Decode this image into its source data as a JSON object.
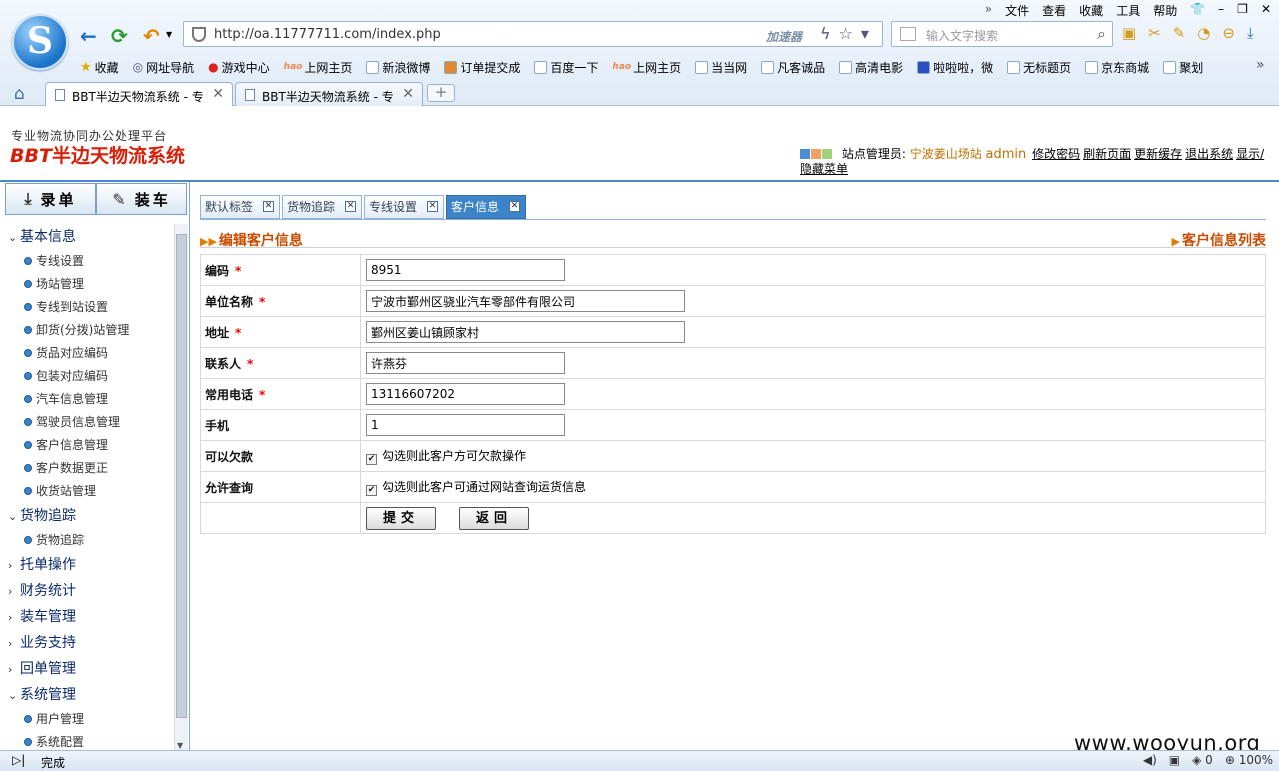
{
  "browser": {
    "menu": [
      "文件",
      "查看",
      "收藏",
      "工具",
      "帮助"
    ],
    "address": "http://oa.11777711.com/index.php",
    "accelerator": "加速器",
    "search_placeholder": "输入文字搜索",
    "bookmarks": [
      "收藏",
      "网址导航",
      "游戏中心",
      "上网主页",
      "新浪微博",
      "订单提交成",
      "百度一下",
      "上网主页",
      "当当网",
      "凡客诚品",
      "高清电影",
      "啦啦啦，微",
      "无标题页",
      "京东商城",
      "聚划"
    ],
    "tabs": [
      "BBT半边天物流系统 - 专",
      "BBT半边天物流系统 - 专"
    ],
    "status": "完成",
    "zoom": "100%",
    "counter": "0"
  },
  "header": {
    "slogan": "专业物流协同办公处理平台",
    "brand_prefix": "BBT",
    "brand_name": "半边天物流系统",
    "admin_label": "站点管理员:",
    "site": "宁波姜山场站",
    "user": "admin",
    "links": [
      "修改密码",
      "刷新页面",
      "更新缓存",
      "退出系统",
      "显示/隐藏菜单"
    ]
  },
  "sidebar": {
    "btn_record": "录单",
    "btn_load": "装车",
    "groups": [
      {
        "label": "基本信息",
        "open": true,
        "items": [
          "专线设置",
          "场站管理",
          "专线到站设置",
          "卸货(分拨)站管理",
          "货品对应编码",
          "包装对应编码",
          "汽车信息管理",
          "驾驶员信息管理",
          "客户信息管理",
          "客户数据更正",
          "收货站管理"
        ]
      },
      {
        "label": "货物追踪",
        "open": true,
        "items": [
          "货物追踪"
        ]
      },
      {
        "label": "托单操作",
        "open": false,
        "items": []
      },
      {
        "label": "财务统计",
        "open": false,
        "items": []
      },
      {
        "label": "装车管理",
        "open": false,
        "items": []
      },
      {
        "label": "业务支持",
        "open": false,
        "items": []
      },
      {
        "label": "回单管理",
        "open": false,
        "items": []
      },
      {
        "label": "系统管理",
        "open": true,
        "items": [
          "用户管理",
          "系统配置"
        ]
      }
    ]
  },
  "content": {
    "tabs": [
      "默认标签",
      "货物追踪",
      "专线设置",
      "客户信息"
    ],
    "active_tab": 3,
    "title": "编辑客户信息",
    "list_link": "客户信息列表",
    "fields": {
      "code": {
        "label": "编码",
        "value": "8951"
      },
      "company": {
        "label": "单位名称",
        "value": "宁波市鄞州区骁业汽车零部件有限公司"
      },
      "address": {
        "label": "地址",
        "value": "鄞州区姜山镇顾家村"
      },
      "contact": {
        "label": "联系人",
        "value": "许燕芬"
      },
      "phone": {
        "label": "常用电话",
        "value": "13116607202"
      },
      "mobile": {
        "label": "手机",
        "value": "1"
      }
    },
    "credit": {
      "label": "可以欠款",
      "text": "勾选则此客户方可欠款操作",
      "checked": true
    },
    "query": {
      "label": "允许查询",
      "text": "勾选则此客户可通过网站查询运货信息",
      "checked": true
    },
    "submit": "提交",
    "back": "返回"
  },
  "watermark": "www.wooyun.org"
}
